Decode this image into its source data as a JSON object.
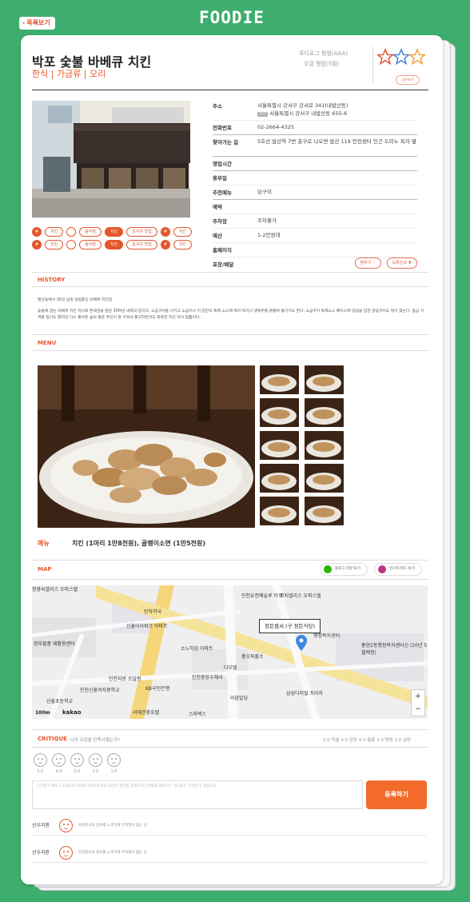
{
  "header": {
    "back_label": "목록보기",
    "logo": "FOODIE"
  },
  "restaurant": {
    "name": "박포 숯불 바베큐 치킨",
    "category": "한식 | 가금류 | 오리",
    "rating_foodie": "푸디로그 평점(AAA)",
    "rating_user": "오감 평점(5점)",
    "share_label": "공유하기"
  },
  "tags_row1": [
    "치킨",
    "",
    "음식점",
    "치킨",
    "강서구 맛집",
    "",
    "치킨"
  ],
  "tags_row2": [
    "치킨",
    "",
    "음식점",
    "치킨",
    "강서구 맛집",
    "",
    "치킨"
  ],
  "info": {
    "address_label": "주소",
    "address_road": "서울특별시 강서구 강서로 341(내발산동)",
    "address_badge": "지번",
    "address_jibun": "서울특별시 강서구 내발산동 655-6",
    "phone_label": "전화번호",
    "phone": "02-2664-4325",
    "directions_label": "찾아가는 길",
    "directions": "5호선 발산역 7번 출구로 나오면 발산 119 안전센터 인근 도미노 피자 옆",
    "hours_label": "영업시간",
    "hours": "",
    "closed_label": "휴무일",
    "closed": "",
    "recommend_label": "추천메뉴",
    "recommend": "닭구이",
    "reservation_label": "예약",
    "reservation": "",
    "parking_label": "주차장",
    "parking": "주차불가",
    "budget_label": "예산",
    "budget": "1-2만원대",
    "homepage_label": "홈페이지",
    "homepage": "",
    "takeout_label": "포장/배달",
    "like_label": "찜하기",
    "report_label": "오류신고"
  },
  "history": {
    "title": "HISTORY",
    "p1": "발산동에서 30년 넘게 성업중인 바베큐 치킨집.",
    "p2": "숯불에 굽는 바베큐 치킨 하나로 존재감을 알린 30여년 내력의 집이다. 소금구이를 시키고 소금이나 이 집만의 특제 소스에 찍어 먹거나 생맥주를 곁들여 즐기기도 한다. 소금구이 특제소스 베이스에 양념을 입힌 양념구이도 많이 찾는다. 점심 가격를 접기도 했지만 다시 돌아온 솜씨 좋은 주인이 잘 구워내 쫄깃하면서도 촉촉한 치킨 맛이 일품이다."
  },
  "menu": {
    "title": "MENU",
    "label": "메뉴",
    "items_text": "치킨 (1마리 1만8천원), 골뱅이소면 (1만5천원)"
  },
  "map": {
    "title": "MAP",
    "naver_btn": "블로그 리뷰 보기",
    "insta_btn": "인스타 피드 보기",
    "marker_label": "정든쌈서 (구 정든식당)",
    "scale": "100m",
    "brand": "kakao",
    "places": [
      "정광씨엘리스 오피스텔",
      "인천유천메슬루 타워",
      "코지엘리스 오피스텔",
      "인하약국",
      "신흥아이파크 아파트",
      "정부물품 재활용센터",
      "소노하임 아파트",
      "홍오파출소",
      "인천지방 조달청",
      "인천중앙우체국",
      "신흥초등학교",
      "KB국민은행",
      "서해관광호텔",
      "인천신흥여자중학교",
      "삼성디지털 프라자",
      "행정복지센터",
      "홍현2동행정복지센터신 (20년 5월예정)",
      "다모텔",
      "라움빌딩",
      "스파렉스"
    ]
  },
  "critique": {
    "title": "CRITIQUE",
    "question": "- 나의 오감을 만족시켰는가?",
    "summary": "5.0 탁월 4.5 감동 4.0 훌륭 3.0 평범 2.0 실망",
    "scores": [
      "5.0",
      "4.0",
      "3.0",
      "2.0",
      "1.0"
    ],
    "placeholder": "오감평가 예측시 2000자 이하로 작성해주세요 타인의 권리를 침해하거나 명예를 훼손하는 게시물은 삭제될 수 있습니다.",
    "submit": "등록하기",
    "reviews": [
      {
        "user": "선우지환",
        "text": "오던한식의 장수를 느끼기에 부족함이 없는 곳."
      },
      {
        "user": "선우지환",
        "text": "오던한식의 장수를 느끼기에 부족함이 없는 곳."
      }
    ]
  },
  "colors": {
    "accent": "#e4572e",
    "background": "#3dae6e",
    "button": "#f26b2a"
  }
}
